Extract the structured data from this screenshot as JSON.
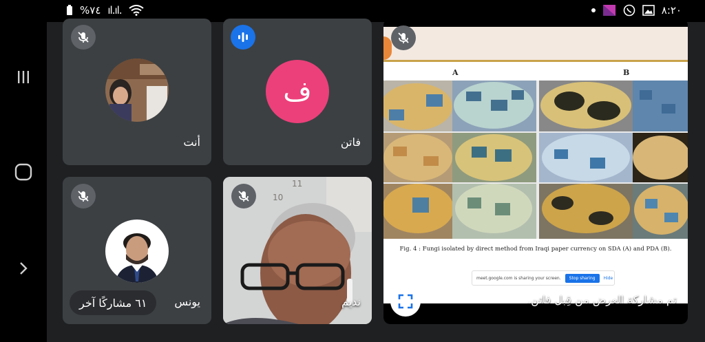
{
  "statusbar": {
    "battery": "%٧٤",
    "signal": "ıl.ıl.",
    "time": "٨:٢٠"
  },
  "tiles": {
    "you": {
      "name": "أنت",
      "icon": "mic-off-icon"
    },
    "faten": {
      "name": "فاتن",
      "initial": "ف",
      "avatar_color": "#ec407a",
      "icon": "audio-active-icon"
    },
    "younes": {
      "name": "يونس",
      "icon": "mic-off-icon"
    },
    "nadeem": {
      "name": "نديم",
      "icon": "mic-off-icon"
    },
    "others": {
      "label": "٦١ مشاركًا آخر"
    }
  },
  "presentation": {
    "panel_a": "A",
    "panel_b": "B",
    "caption": "Fig. 4 : Fungi isolated by direct method from Iraqi paper currency on SDA (A) and PDA (B).",
    "share_text": "meet.google.com is sharing your screen.",
    "stop_label": "Stop sharing",
    "hide_label": "Hide",
    "presenting_text": "تم مشاركة العرض من قِبل فاتن."
  },
  "colors": {
    "tile_bg": "#3c4043",
    "page_bg": "#1f2022",
    "accent_blue": "#1a73e8"
  }
}
